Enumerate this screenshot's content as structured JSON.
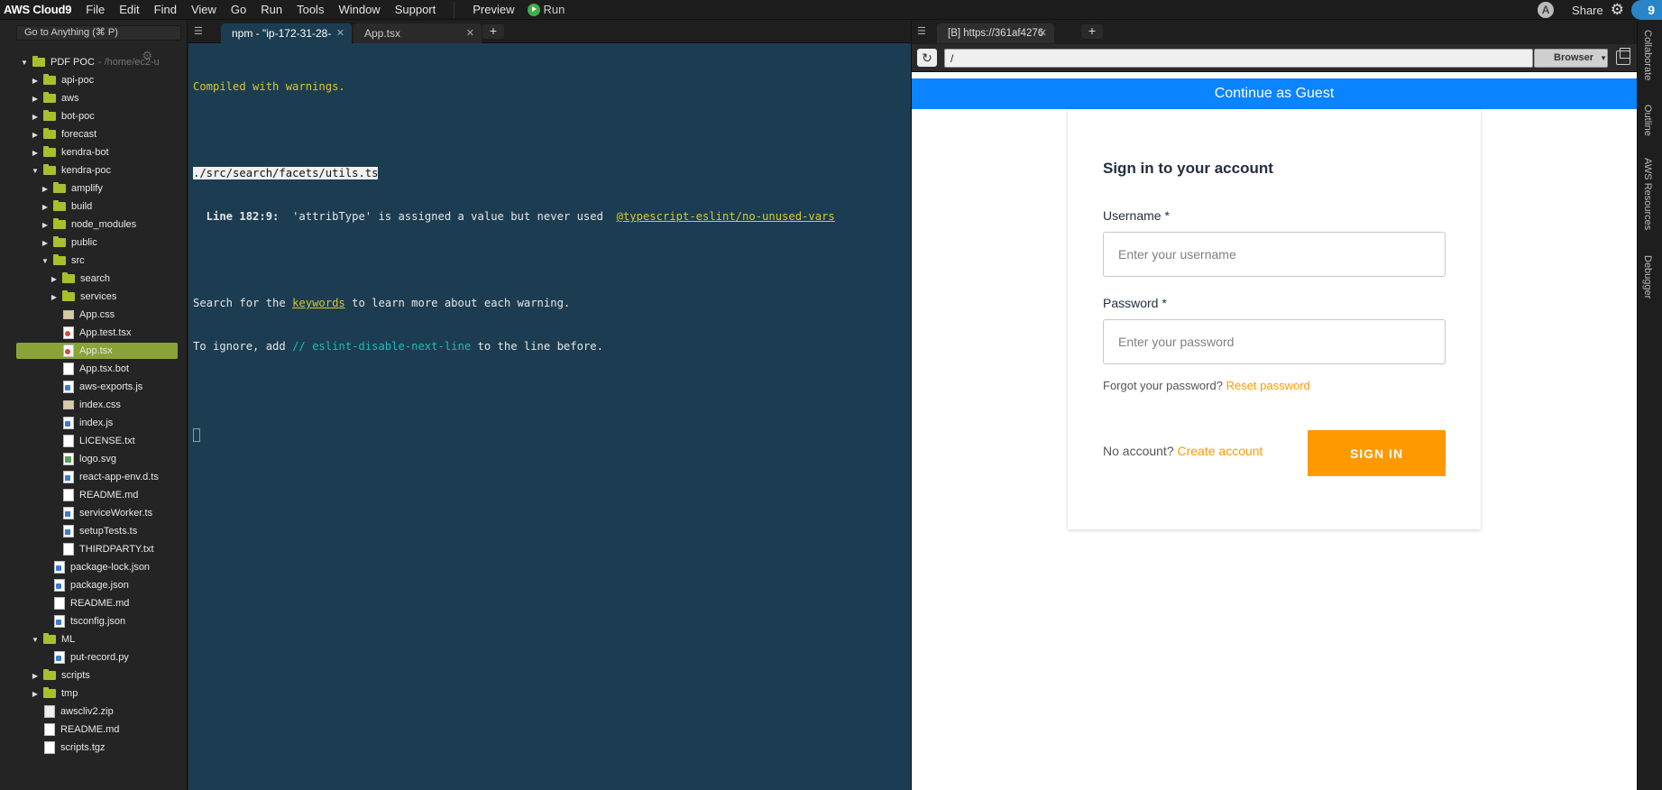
{
  "menubar": {
    "brand": "AWS Cloud9",
    "items": [
      "File",
      "Edit",
      "Find",
      "View",
      "Go",
      "Run",
      "Tools",
      "Window",
      "Support"
    ],
    "preview_label": "Preview",
    "run_label": "Run",
    "avatar_initial": "A",
    "share_label": "Share",
    "cloud_badge": "9"
  },
  "sidebar": {
    "goto_placeholder": "Go to Anything (⌘ P)",
    "tree": [
      {
        "label": "PDF POC",
        "type": "folder",
        "depth": 0,
        "open": true,
        "suffix": "- /home/ec2-u"
      },
      {
        "label": "api-poc",
        "type": "folder",
        "depth": 1,
        "open": false
      },
      {
        "label": "aws",
        "type": "folder",
        "depth": 1,
        "open": false
      },
      {
        "label": "bot-poc",
        "type": "folder",
        "depth": 1,
        "open": false
      },
      {
        "label": "forecast",
        "type": "folder",
        "depth": 1,
        "open": false
      },
      {
        "label": "kendra-bot",
        "type": "folder",
        "depth": 1,
        "open": false
      },
      {
        "label": "kendra-poc",
        "type": "folder",
        "depth": 1,
        "open": true
      },
      {
        "label": "amplify",
        "type": "folder",
        "depth": 2,
        "open": false
      },
      {
        "label": "build",
        "type": "folder",
        "depth": 2,
        "open": false
      },
      {
        "label": "node_modules",
        "type": "folder",
        "depth": 2,
        "open": false
      },
      {
        "label": "public",
        "type": "folder",
        "depth": 2,
        "open": false
      },
      {
        "label": "src",
        "type": "folder",
        "depth": 2,
        "open": true
      },
      {
        "label": "search",
        "type": "folder",
        "depth": 3,
        "open": false
      },
      {
        "label": "services",
        "type": "folder",
        "depth": 3,
        "open": false
      },
      {
        "label": "App.css",
        "type": "css",
        "depth": 3
      },
      {
        "label": "App.test.tsx",
        "type": "tsx",
        "depth": 3
      },
      {
        "label": "App.tsx",
        "type": "tsx",
        "depth": 3,
        "selected": true
      },
      {
        "label": "App.tsx.bot",
        "type": "txt",
        "depth": 3
      },
      {
        "label": "aws-exports.js",
        "type": "js",
        "depth": 3
      },
      {
        "label": "index.css",
        "type": "css",
        "depth": 3
      },
      {
        "label": "index.js",
        "type": "js",
        "depth": 3
      },
      {
        "label": "LICENSE.txt",
        "type": "txt",
        "depth": 3
      },
      {
        "label": "logo.svg",
        "type": "svg",
        "depth": 3
      },
      {
        "label": "react-app-env.d.ts",
        "type": "ts",
        "depth": 3
      },
      {
        "label": "README.md",
        "type": "txt",
        "depth": 3
      },
      {
        "label": "serviceWorker.ts",
        "type": "ts",
        "depth": 3
      },
      {
        "label": "setupTests.ts",
        "type": "ts",
        "depth": 3
      },
      {
        "label": "THIRDPARTY.txt",
        "type": "txt",
        "depth": 3
      },
      {
        "label": "package-lock.json",
        "type": "js",
        "depth": 2
      },
      {
        "label": "package.json",
        "type": "js",
        "depth": 2
      },
      {
        "label": "README.md",
        "type": "txt",
        "depth": 2
      },
      {
        "label": "tsconfig.json",
        "type": "js",
        "depth": 2
      },
      {
        "label": "ML",
        "type": "folder",
        "depth": 1,
        "open": true
      },
      {
        "label": "put-record.py",
        "type": "js",
        "depth": 2
      },
      {
        "label": "scripts",
        "type": "folder",
        "depth": 1,
        "open": false
      },
      {
        "label": "tmp",
        "type": "folder",
        "depth": 1,
        "open": false
      },
      {
        "label": "awscliv2.zip",
        "type": "zip",
        "depth": 1
      },
      {
        "label": "README.md",
        "type": "txt",
        "depth": 1
      },
      {
        "label": "scripts.tgz",
        "type": "txt",
        "depth": 1
      }
    ]
  },
  "terminal": {
    "tabs": [
      {
        "label": "npm - \"ip-172-31-28-",
        "active": true
      },
      {
        "label": "App.tsx",
        "active": false
      }
    ],
    "compiled": "Compiled with warnings.",
    "file_path": "./src/search/facets/utils.ts",
    "line_ref": "  Line 182:9:",
    "warning_text": "  'attribType' is assigned a value but never used  ",
    "rule_link": "@typescript-eslint/no-unused-vars",
    "search_prefix": "Search for the ",
    "keywords_link": "keywords",
    "search_suffix": " to learn more about each warning.",
    "ignore_prefix": "To ignore, add ",
    "ignore_code": "// eslint-disable-next-line",
    "ignore_suffix": " to the line before."
  },
  "preview": {
    "tab_label": "[B] https://361af4276",
    "url": "/",
    "browser_label": "Browser",
    "guest_label": "Continue as Guest",
    "card": {
      "title": "Sign in to your account",
      "username_label": "Username",
      "username_placeholder": "Enter your username",
      "password_label": "Password",
      "password_placeholder": "Enter your password",
      "required_mark": "*",
      "forgot_text": "Forgot your password?",
      "reset_link": "Reset password",
      "no_account_text": "No account?",
      "create_link": "Create account",
      "signin_label": "SIGN IN"
    }
  },
  "right_strip": [
    "Collaborate",
    "Outline",
    "AWS Resources",
    "Debugger"
  ],
  "colors": {
    "accent_blue": "#0a84ff",
    "amplify_orange": "#ff9900",
    "selection_green": "#8aa337",
    "terminal_bg": "#1c3d51"
  }
}
